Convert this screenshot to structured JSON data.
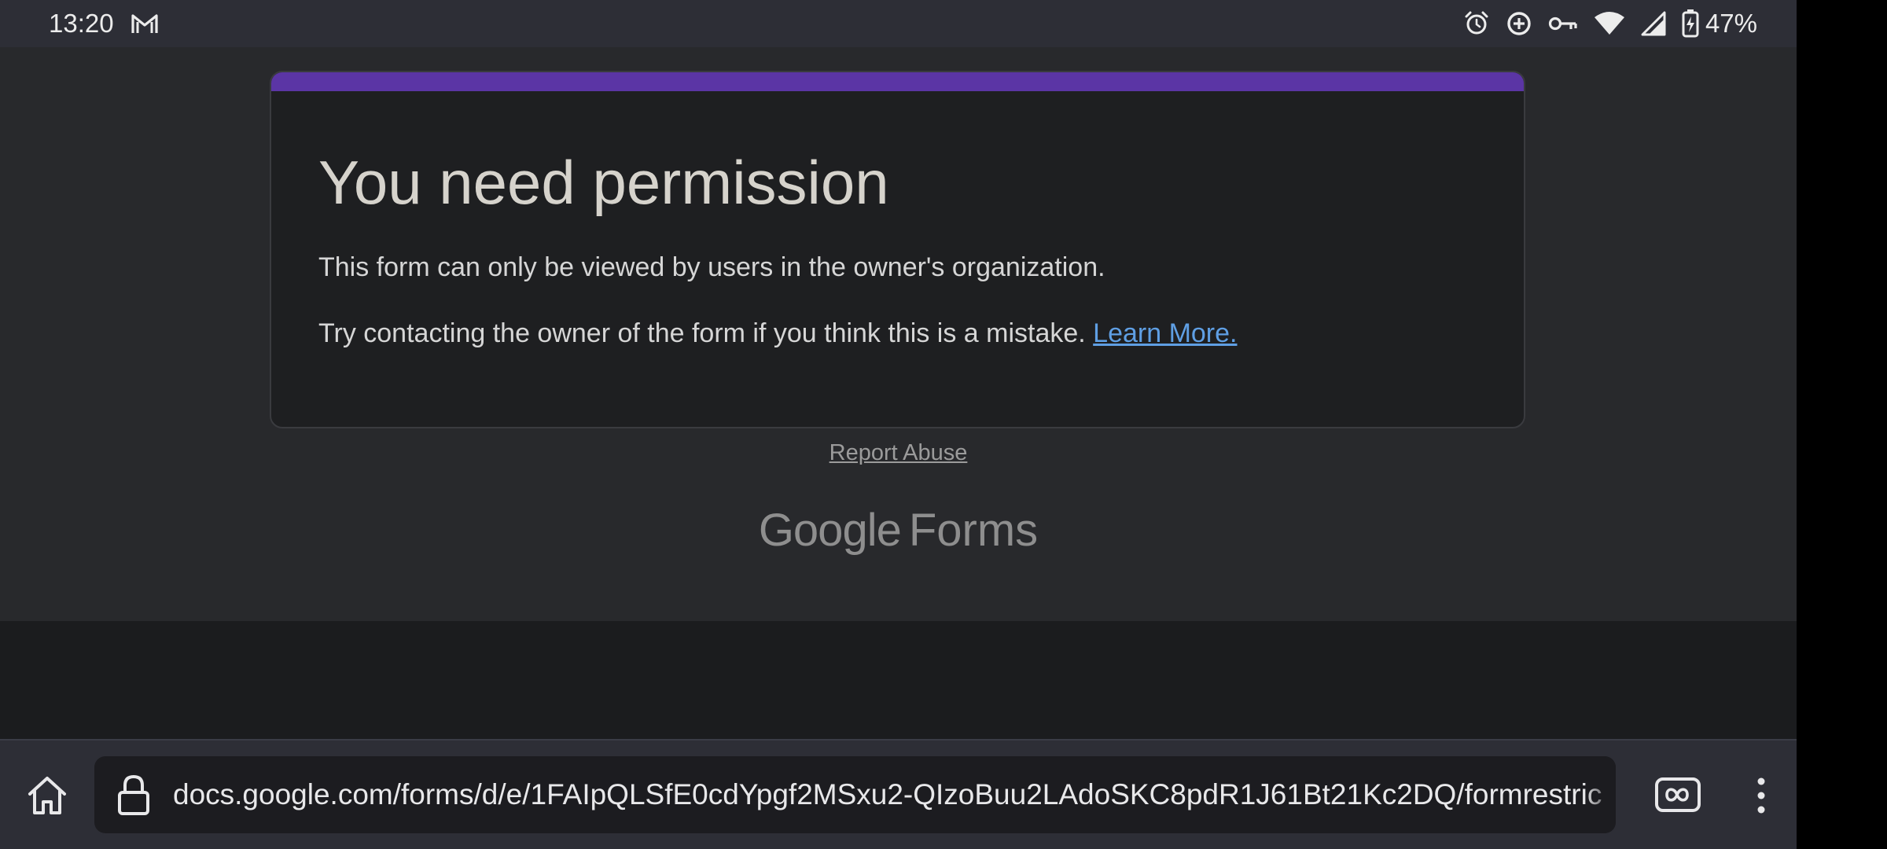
{
  "status_bar": {
    "time": "13:20",
    "notification_icons": [
      "gmail-icon"
    ],
    "system_icons": [
      "alarm-icon",
      "data-saver-icon",
      "vpn-key-icon",
      "wifi-icon",
      "cell-signal-icon",
      "battery-charging-icon"
    ],
    "battery_percent": "47%"
  },
  "card": {
    "title": "You need permission",
    "message": "This form can only be viewed by users in the owner's organization.",
    "hint": "Try contacting the owner of the form if you think this is a mistake.",
    "link_label": "Learn More."
  },
  "footer": {
    "report_abuse": "Report Abuse",
    "logo_google": "Google",
    "logo_forms": "Forms"
  },
  "toolbar": {
    "url": "docs.google.com/forms/d/e/1FAIpQLSfE0cdYpgf2MSxu2-QIzoBuu2LAdoSKC8pdR1J61Bt21Kc2DQ/formrestric",
    "icons": [
      "home-icon",
      "lock-icon",
      "tabs-icon",
      "more-vert-icon"
    ]
  },
  "colors": {
    "accent": "#5b35a5",
    "link": "#5f9fe4",
    "page_bg": "#28292c",
    "card_bg": "#1e1f21",
    "chrome_bg": "#2d2e36"
  }
}
